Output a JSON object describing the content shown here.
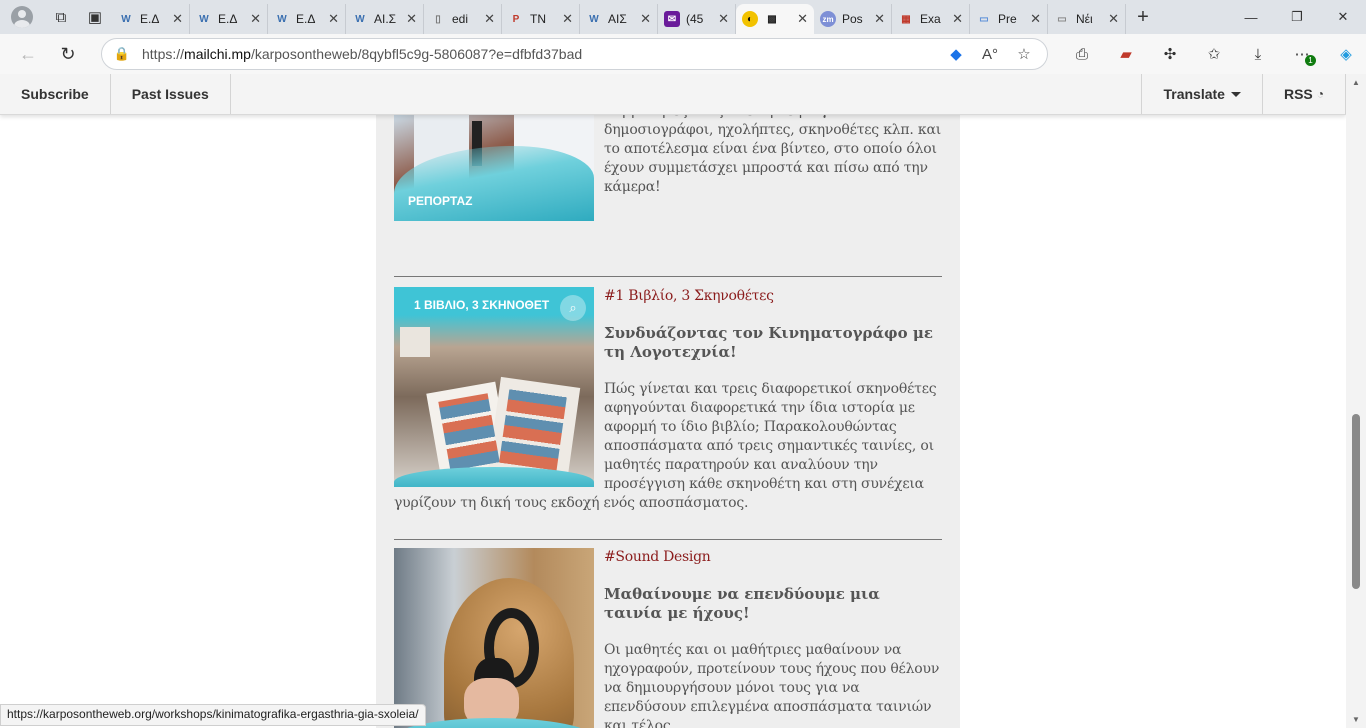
{
  "browser": {
    "tabs": [
      {
        "title": "Ε.Δ",
        "icon": "W",
        "color": "#3a6fb0"
      },
      {
        "title": "Ε.Δ",
        "icon": "W",
        "color": "#3a6fb0"
      },
      {
        "title": "Ε.Δ",
        "icon": "W",
        "color": "#3a6fb0"
      },
      {
        "title": "ΑΙ.Σ",
        "icon": "W",
        "color": "#3a6fb0"
      },
      {
        "title": "edi",
        "icon": "doc",
        "color": "#777777"
      },
      {
        "title": "ΤΝ",
        "icon": "pdf",
        "color": "#c0392b"
      },
      {
        "title": "ΑΙΣ",
        "icon": "W",
        "color": "#3a6fb0"
      },
      {
        "title": "(45",
        "icon": "mail",
        "color": "#6a1b9a"
      },
      {
        "title": "",
        "icon": "mc",
        "color": "#f2c200",
        "active": true
      },
      {
        "title": "Pos",
        "icon": "zm",
        "color": "#7d8fd6"
      },
      {
        "title": "Exa",
        "icon": "grid",
        "color": "#c0392b"
      },
      {
        "title": "Pre",
        "icon": "pre",
        "color": "#5b8fd9"
      },
      {
        "title": "Νέι",
        "icon": "blank",
        "color": "#888888"
      }
    ],
    "url_prefix": "https://",
    "url_host": "mailchi.mp",
    "url_path": "/karposontheweb/8qybfl5c9g-5806087?e=dfbfd37bad",
    "notification_count": "1"
  },
  "header": {
    "subscribe": "Subscribe",
    "past_issues": "Past Issues",
    "translate": "Translate",
    "rss": "RSS"
  },
  "articles": [
    {
      "image_caption": "ΡΕΠΟΡΤΑΖ",
      "tag": "",
      "title": "",
      "body": "Στο Εργαστήριο Ρεπορτάζ οι μαθητές και οι μαθήτριες στήνουν το δικό τους επαγγελματικό συνεργείο και υλοποιούν ένα ρεπορτάζ με τους συμμαθητές τους. Με τη σειρά γίνονται δημοσιογράφοι, ηχολήπτες, σκηνοθέτες κλπ.  και το αποτέλεσμα είναι ένα βίντεο, στο οποίο όλοι έχουν συμμετάσχει μπροστά και πίσω από την κάμερα!"
    },
    {
      "image_caption": "1 ΒΙΒΛΙΟ, 3 ΣΚΗΝΟΘΕΤ",
      "tag": "#1 Βιβλίο, 3 Σκηνοθέτες",
      "title": "Συνδυάζοντας τον Κινηματογράφο με τη Λογοτεχνία!",
      "body": "Πώς γίνεται και τρεις διαφορετικοί σκηνοθέτες αφηγούνται διαφορετικά την ίδια ιστορία με αφορμή το ίδιο βιβλίο; Παρακολουθώντας αποσπάσματα από τρεις σημαντικές ταινίες, οι μαθητές παρατηρούν και αναλύουν την προσέγγιση κάθε σκηνοθέτη και στη συνέχεια γυρίζουν τη δική τους εκδοχή ενός αποσπάσματος."
    },
    {
      "image_caption": "",
      "tag": "#Sound Design",
      "title": "Μαθαίνουμε να επενδύουμε μια ταινία με ήχους!",
      "body": "Οι μαθητές και οι μαθήτριες μαθαίνουν να ηχογραφούν, προτείνουν τους ήχους που θέλουν να δημιουργήσουν μόνοι τους για να επενδύσουν επιλεγμένα αποσπάσματα ταινιών και τέλος"
    }
  ],
  "status_url": "https://karposontheweb.org/workshops/kinimatografika-ergasthria-gia-sxoleia/"
}
